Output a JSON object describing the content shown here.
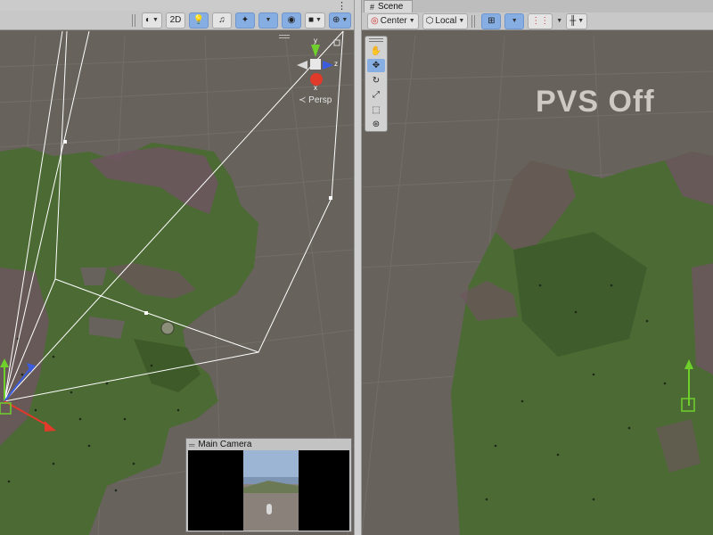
{
  "left_view": {
    "toolbar": {
      "mode_2d_label": "2D"
    },
    "gizmo": {
      "axis_y": "y",
      "axis_z": "z",
      "axis_x": "x",
      "projection_label": "Persp"
    },
    "camera_preview": {
      "title": "Main Camera"
    }
  },
  "right_view": {
    "tab_label": "Scene",
    "toolbar": {
      "pivot_label": "Center",
      "space_label": "Local"
    },
    "overlay_text": "PVS Off"
  },
  "colors": {
    "toolbar_bg": "#c8c8c8",
    "active_blue": "#86aee3",
    "ground": "#67625c",
    "grass": "#4c6a33",
    "rock": "#6e5560"
  }
}
